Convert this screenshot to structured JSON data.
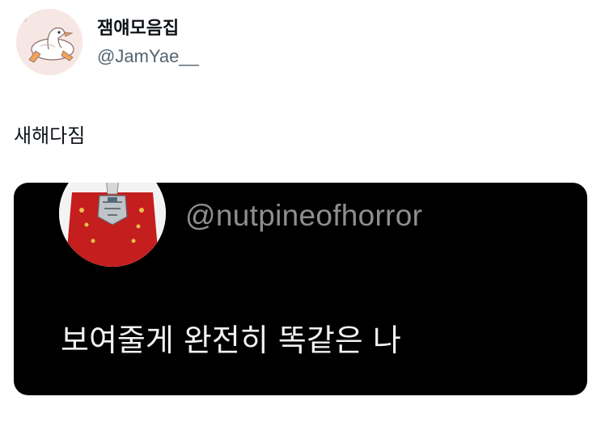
{
  "author": {
    "display_name": "잼얘모음집",
    "handle": "@JamYae__",
    "avatar_icon": "goose-avatar-icon"
  },
  "tweet": {
    "text": "새해다짐"
  },
  "embedded_tweet": {
    "handle": "@nutpineofhorror",
    "avatar_icon": "knight-avatar-icon",
    "text": "보여줄게 완전히 똑같은 나"
  }
}
